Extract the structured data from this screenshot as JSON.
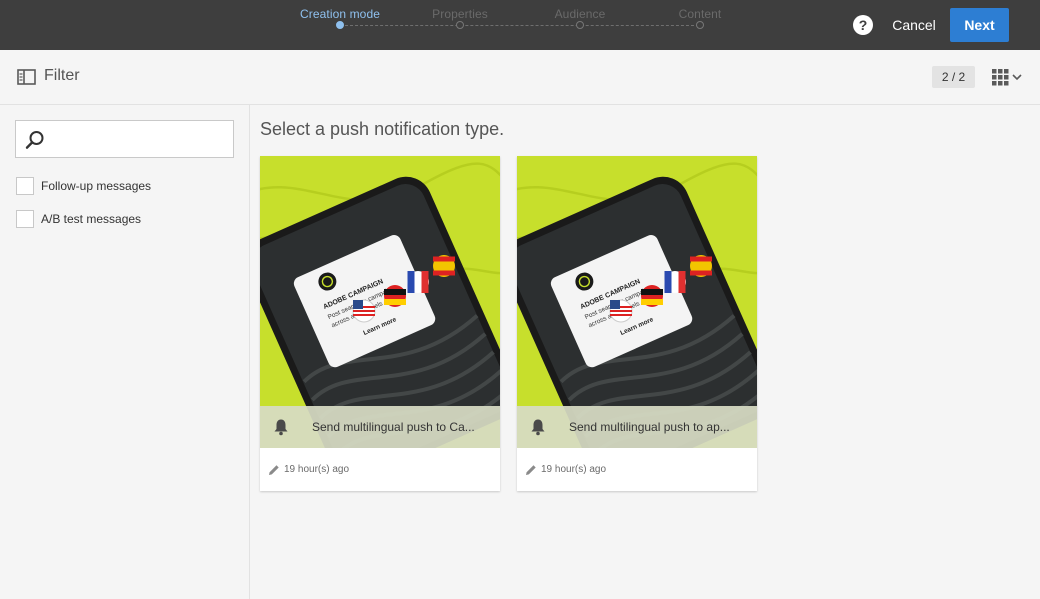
{
  "wizard": {
    "steps": [
      {
        "label": "Creation mode",
        "active": true
      },
      {
        "label": "Properties",
        "active": false
      },
      {
        "label": "Audience",
        "active": false
      },
      {
        "label": "Content",
        "active": false
      }
    ],
    "help_label": "?",
    "cancel_label": "Cancel",
    "next_label": "Next"
  },
  "toolbar": {
    "filter_label": "Filter",
    "page_count": "2 / 2"
  },
  "sidebar": {
    "search": {
      "placeholder": "",
      "value": ""
    },
    "filters": [
      {
        "label": "Follow-up messages",
        "checked": false
      },
      {
        "label": "A/B test messages",
        "checked": false
      }
    ]
  },
  "main": {
    "title": "Select a push notification type.",
    "cards": [
      {
        "title": "Send multilingual push to Ca...",
        "time": "19 hour(s) ago",
        "image": {
          "brand": "ADOBE CAMPAIGN",
          "line1": "Post seamless campaigns",
          "line2": "across all channels",
          "cta": "Learn more"
        }
      },
      {
        "title": "Send multilingual push to ap...",
        "time": "19 hour(s) ago",
        "image": {
          "brand": "ADOBE CAMPAIGN",
          "line1": "Post seamless campaigns",
          "line2": "across all channels",
          "cta": "Learn more"
        }
      }
    ]
  },
  "colors": {
    "topbar": "#3e3e3e",
    "accent": "#2d7ed3",
    "active_step": "#8fc0ee",
    "lime": "#c7df2c"
  }
}
